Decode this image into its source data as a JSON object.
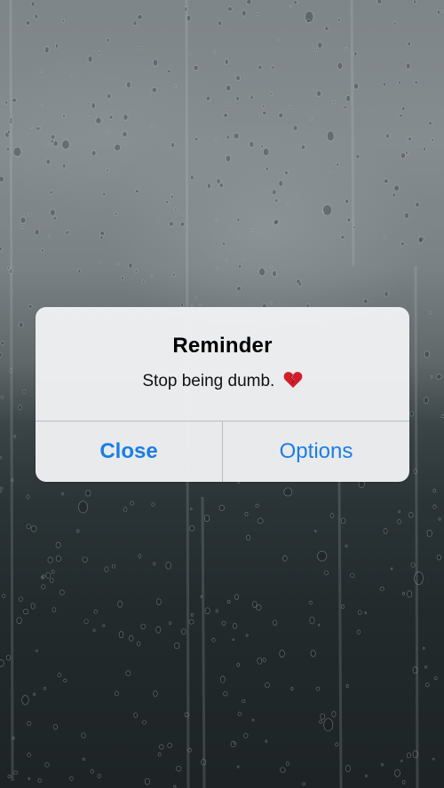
{
  "alert": {
    "title": "Reminder",
    "message": "Stop being dumb.",
    "message_icon": "broken-heart-icon",
    "buttons": {
      "close_label": "Close",
      "options_label": "Options"
    }
  },
  "colors": {
    "button_text": "#1a7ee6",
    "alert_background": "#f0f1f2",
    "divider": "#b9bcbf"
  }
}
